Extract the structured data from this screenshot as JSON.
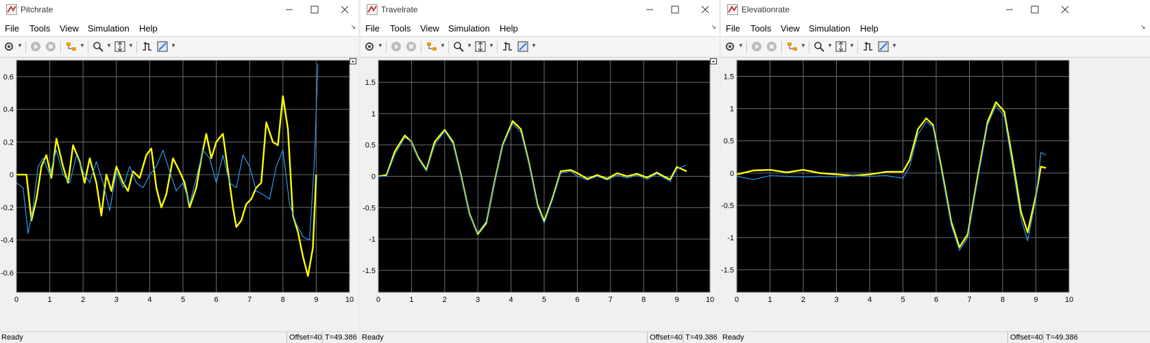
{
  "menus": [
    "File",
    "Tools",
    "View",
    "Simulation",
    "Help"
  ],
  "status": {
    "ready": "Ready",
    "offset": "Offset=40",
    "time": "T=49.386"
  },
  "colors": {
    "background": "#000000",
    "grid": "#6e6e6e",
    "reference": "#ffff00",
    "measured": "#2b9bf4"
  },
  "icons": [
    "settings-icon",
    "run-icon",
    "stop-icon",
    "highlight-blocks-icon",
    "zoom-icon",
    "scale-axes-icon",
    "triggers-icon",
    "style-icon",
    "minimize-icon",
    "maximize-icon",
    "close-icon",
    "undock-icon"
  ],
  "scopes": [
    {
      "title": "Pitchrate",
      "chart_data": {
        "type": "line",
        "xlim": [
          0,
          10
        ],
        "ylim": [
          -0.72,
          0.7
        ],
        "xticks": [
          "0",
          "1",
          "2",
          "3",
          "4",
          "5",
          "6",
          "7",
          "8",
          "9",
          "10"
        ],
        "yticks": [
          "-0.6",
          "-0.4",
          "-0.2",
          "0",
          "0.2",
          "0.4",
          "0.6"
        ],
        "grid": true,
        "series": [
          {
            "color": "#ffff00",
            "x": [
              0,
              0.3,
              0.45,
              0.6,
              0.75,
              0.9,
              1.05,
              1.2,
              1.4,
              1.55,
              1.7,
              1.9,
              2.05,
              2.2,
              2.4,
              2.55,
              2.7,
              2.85,
              3.0,
              3.2,
              3.35,
              3.5,
              3.7,
              3.9,
              4.05,
              4.2,
              4.35,
              4.5,
              4.7,
              4.9,
              5.05,
              5.2,
              5.4,
              5.55,
              5.7,
              5.85,
              6.0,
              6.2,
              6.4,
              6.5,
              6.6,
              6.75,
              6.9,
              7.05,
              7.2,
              7.35,
              7.5,
              7.7,
              7.85,
              8.0,
              8.15,
              8.3,
              8.45,
              8.6,
              8.75,
              8.9,
              9.0
            ],
            "y": [
              0,
              0,
              -0.28,
              -0.15,
              0.05,
              0.12,
              -0.02,
              0.22,
              0.05,
              -0.05,
              0.18,
              0.08,
              -0.05,
              0.1,
              -0.05,
              -0.25,
              0,
              -0.1,
              0.05,
              -0.05,
              -0.1,
              0.02,
              -0.02,
              0.12,
              0.16,
              -0.08,
              -0.2,
              -0.12,
              0.1,
              0.02,
              -0.05,
              -0.2,
              -0.08,
              0.1,
              0.25,
              0.1,
              0.2,
              0.25,
              -0.05,
              -0.2,
              -0.32,
              -0.28,
              -0.18,
              -0.15,
              -0.08,
              -0.05,
              0.32,
              0.2,
              0.18,
              0.48,
              0.28,
              -0.25,
              -0.35,
              -0.5,
              -0.62,
              -0.45,
              0.0
            ]
          },
          {
            "color": "#2b9bf4",
            "x": [
              0,
              0.2,
              0.35,
              0.5,
              0.65,
              0.8,
              1.0,
              1.2,
              1.4,
              1.6,
              1.8,
              2.0,
              2.2,
              2.4,
              2.6,
              2.8,
              3.0,
              3.2,
              3.4,
              3.6,
              3.8,
              4.0,
              4.2,
              4.4,
              4.6,
              4.8,
              5.0,
              5.2,
              5.4,
              5.6,
              5.8,
              6.0,
              6.2,
              6.4,
              6.6,
              6.8,
              7.0,
              7.2,
              7.4,
              7.6,
              7.8,
              8.0,
              8.2,
              8.4,
              8.6,
              8.8,
              8.95,
              9.05
            ],
            "y": [
              -0.05,
              -0.08,
              -0.36,
              -0.2,
              0.05,
              0.1,
              0,
              0.15,
              0,
              -0.05,
              0.12,
              0.02,
              -0.05,
              0.08,
              -0.05,
              -0.22,
              0.02,
              -0.08,
              0.05,
              -0.05,
              -0.08,
              0.0,
              0.05,
              0.15,
              0.02,
              -0.1,
              -0.05,
              -0.18,
              -0.02,
              0.15,
              0.1,
              -0.05,
              0.12,
              -0.05,
              -0.08,
              0.12,
              0.05,
              -0.1,
              -0.12,
              -0.15,
              0.05,
              0.15,
              -0.18,
              -0.3,
              -0.38,
              -0.4,
              0.1,
              0.68
            ]
          }
        ]
      }
    },
    {
      "title": "Travelrate",
      "chart_data": {
        "type": "line",
        "xlim": [
          0,
          10
        ],
        "ylim": [
          -1.85,
          1.85
        ],
        "xticks": [
          "0",
          "1",
          "2",
          "3",
          "4",
          "5",
          "6",
          "7",
          "8",
          "9",
          "10"
        ],
        "yticks": [
          "-1.5",
          "-1",
          "-0.5",
          "0",
          "0.5",
          "1",
          "1.5"
        ],
        "grid": true,
        "series": [
          {
            "color": "#ffff00",
            "x": [
              0,
              0.25,
              0.5,
              0.8,
              1.0,
              1.2,
              1.45,
              1.7,
              2.0,
              2.25,
              2.5,
              2.75,
              3.0,
              3.25,
              3.5,
              3.75,
              4.05,
              4.3,
              4.55,
              4.8,
              5.0,
              5.25,
              5.5,
              5.8,
              6.0,
              6.3,
              6.6,
              6.9,
              7.2,
              7.5,
              7.8,
              8.1,
              8.4,
              8.6,
              8.8,
              9.0,
              9.3
            ],
            "y": [
              0,
              0.02,
              0.4,
              0.65,
              0.55,
              0.3,
              0.1,
              0.55,
              0.74,
              0.55,
              0.0,
              -0.6,
              -0.92,
              -0.75,
              -0.1,
              0.5,
              0.88,
              0.75,
              0.2,
              -0.45,
              -0.72,
              -0.35,
              0.08,
              0.1,
              0.05,
              -0.04,
              0.02,
              -0.04,
              0.05,
              0.0,
              0.04,
              -0.02,
              0.06,
              0.0,
              -0.05,
              0.15,
              0.08
            ]
          },
          {
            "color": "#2b9bf4",
            "x": [
              0,
              0.25,
              0.5,
              0.8,
              1.0,
              1.2,
              1.45,
              1.7,
              2.0,
              2.25,
              2.5,
              2.75,
              3.0,
              3.25,
              3.5,
              3.75,
              4.05,
              4.3,
              4.55,
              4.8,
              5.0,
              5.25,
              5.5,
              5.8,
              6.0,
              6.3,
              6.6,
              6.9,
              7.2,
              7.5,
              7.8,
              8.1,
              8.4,
              8.6,
              8.8,
              9.0,
              9.3
            ],
            "y": [
              0,
              0.0,
              0.35,
              0.62,
              0.55,
              0.28,
              0.08,
              0.5,
              0.72,
              0.52,
              -0.02,
              -0.62,
              -0.9,
              -0.72,
              -0.12,
              0.48,
              0.84,
              0.7,
              0.18,
              -0.48,
              -0.75,
              -0.38,
              0.05,
              0.08,
              0.0,
              -0.06,
              0.0,
              -0.06,
              0.02,
              -0.03,
              0.02,
              -0.05,
              0.04,
              -0.02,
              -0.08,
              0.12,
              0.18
            ]
          }
        ]
      }
    },
    {
      "title": "Elevationrate",
      "chart_data": {
        "type": "line",
        "xlim": [
          0,
          10
        ],
        "ylim": [
          -1.85,
          1.75
        ],
        "xticks": [
          "0",
          "1",
          "2",
          "3",
          "4",
          "5",
          "6",
          "7",
          "8",
          "9",
          "10"
        ],
        "yticks": [
          "-1.5",
          "-1",
          "-0.5",
          "0",
          "0.5",
          "1",
          "1.5"
        ],
        "grid": true,
        "series": [
          {
            "color": "#ffff00",
            "x": [
              0,
              0.5,
              1.0,
              1.5,
              2.0,
              2.5,
              3.0,
              3.5,
              4.0,
              4.5,
              5.0,
              5.2,
              5.45,
              5.7,
              5.9,
              6.15,
              6.45,
              6.7,
              6.95,
              7.25,
              7.55,
              7.8,
              8.05,
              8.3,
              8.55,
              8.75,
              9.0,
              9.15,
              9.3
            ],
            "y": [
              -0.02,
              0.04,
              0.05,
              0.01,
              0.05,
              0.0,
              -0.02,
              -0.04,
              -0.02,
              0.02,
              0.02,
              0.2,
              0.68,
              0.85,
              0.75,
              0.1,
              -0.75,
              -1.15,
              -0.95,
              -0.05,
              0.8,
              1.1,
              0.95,
              0.2,
              -0.6,
              -0.92,
              -0.35,
              0.1,
              0.08
            ]
          },
          {
            "color": "#2b9bf4",
            "x": [
              0,
              0.5,
              1.0,
              1.5,
              2.0,
              2.5,
              3.0,
              3.5,
              4.0,
              4.5,
              5.0,
              5.2,
              5.45,
              5.7,
              5.9,
              6.15,
              6.45,
              6.7,
              6.95,
              7.25,
              7.55,
              7.8,
              8.05,
              8.3,
              8.55,
              8.75,
              9.0,
              9.15,
              9.3
            ],
            "y": [
              -0.05,
              -0.1,
              -0.04,
              -0.05,
              -0.06,
              -0.05,
              -0.06,
              -0.04,
              -0.05,
              -0.04,
              -0.08,
              0.1,
              0.6,
              0.8,
              0.72,
              0.05,
              -0.8,
              -1.2,
              -1.0,
              -0.1,
              0.75,
              1.05,
              0.88,
              0.1,
              -0.7,
              -1.05,
              -0.4,
              0.32,
              0.28
            ]
          }
        ]
      }
    }
  ]
}
